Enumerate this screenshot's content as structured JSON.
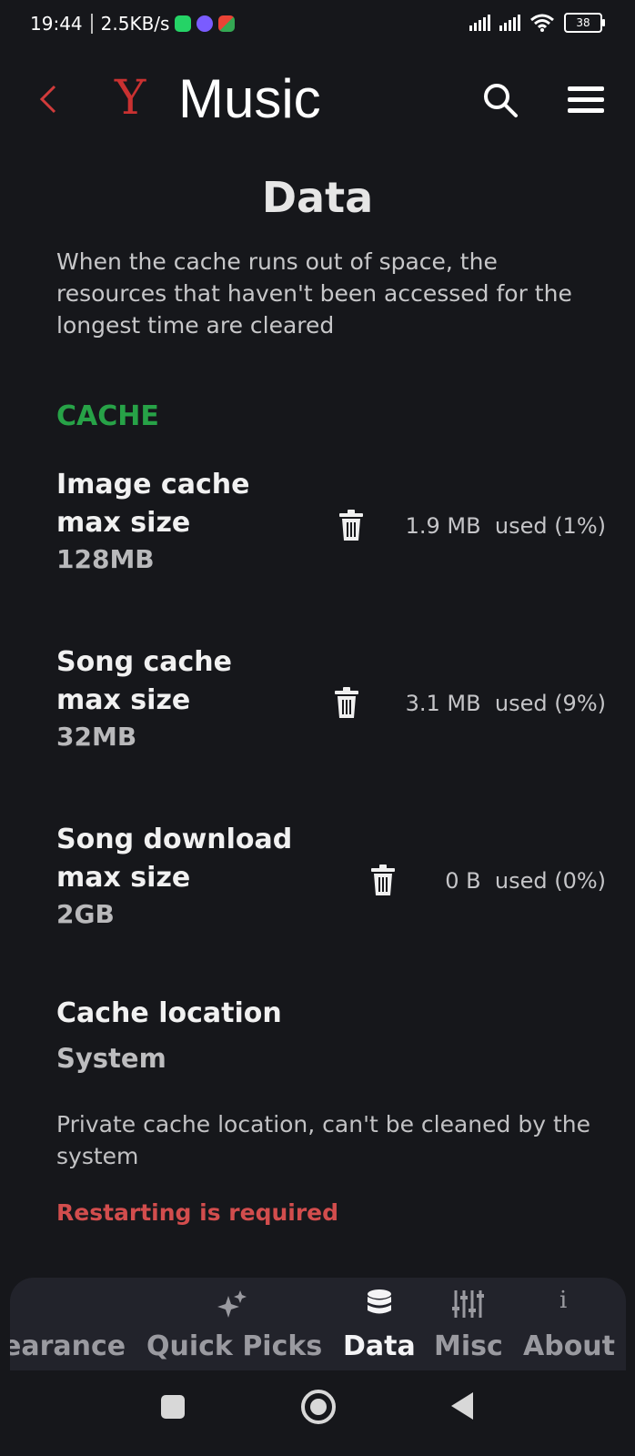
{
  "status_bar": {
    "time": "19:44",
    "speed": "2.5KB/s",
    "battery": "38"
  },
  "app_bar": {
    "logo": "Y",
    "title": "Music"
  },
  "page": {
    "title": "Data",
    "description": "When the cache runs out of space, the resources that haven't been accessed for the longest time are cleared"
  },
  "cache_section": {
    "header": "CACHE",
    "items": [
      {
        "title_line1": "Image cache",
        "title_line2": "max size",
        "value": "128MB",
        "usage": "1.9 MB  used (1%)"
      },
      {
        "title_line1": "Song cache",
        "title_line2": "max size",
        "value": "32MB",
        "usage": "3.1 MB  used (9%)"
      },
      {
        "title_line1": "Song download",
        "title_line2": "max size",
        "value": "2GB",
        "usage": "0 B  used (0%)"
      }
    ]
  },
  "cache_location": {
    "title": "Cache location",
    "value": "System",
    "description": "Private cache location, can't be cleaned by the system",
    "warning": "Restarting is required"
  },
  "bottom_nav": {
    "items": [
      {
        "label": "earance",
        "icon": "appearance-icon"
      },
      {
        "label": "Quick Picks",
        "icon": "sparkles-icon"
      },
      {
        "label": "Data",
        "icon": "database-icon",
        "active": true
      },
      {
        "label": "Misc",
        "icon": "sliders-icon"
      },
      {
        "label": "About",
        "icon": "info-icon"
      }
    ]
  },
  "colors": {
    "background": "#16171b",
    "accent_red": "#c93131",
    "section_green": "#27a247",
    "warning_red": "#d24d4d",
    "nav_background": "#22232b"
  }
}
